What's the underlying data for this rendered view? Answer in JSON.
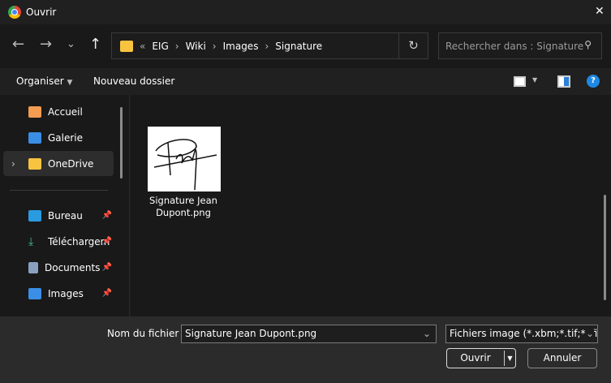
{
  "window": {
    "title": "Ouvrir",
    "close": "✕"
  },
  "nav": {
    "back": "←",
    "forward": "→",
    "recent": "⌄",
    "up": "↑",
    "breadcrumb": [
      "EIG",
      "Wiki",
      "Images",
      "Signature"
    ],
    "overflow": "«",
    "refresh": "↻"
  },
  "search": {
    "placeholder": "Rechercher dans : Signature"
  },
  "toolbar": {
    "organize": "Organiser",
    "new_folder": "Nouveau dossier"
  },
  "sidebar": {
    "items": [
      {
        "label": "Accueil",
        "icon": "home-icon"
      },
      {
        "label": "Galerie",
        "icon": "gallery-icon"
      },
      {
        "label": "OneDrive",
        "icon": "folder-icon",
        "selected": true
      },
      {
        "label": "Bureau",
        "icon": "desktop-icon",
        "pinned": true
      },
      {
        "label": "Téléchargem",
        "icon": "download-icon",
        "pinned": true
      },
      {
        "label": "Documents",
        "icon": "documents-icon",
        "pinned": true
      },
      {
        "label": "Images",
        "icon": "images-icon",
        "pinned": true
      }
    ]
  },
  "files": [
    {
      "name_line1": "Signature Jean",
      "name_line2": "Dupont.png"
    }
  ],
  "bottom": {
    "filename_label": "Nom du fichier :",
    "filename_value": "Signature Jean Dupont.png",
    "filetype": "Fichiers image (*.xbm;*.tif;*.jfif;",
    "open": "Ouvrir",
    "cancel": "Annuler"
  },
  "colors": {
    "accent": "#0078d4",
    "folder": "#f8c440"
  }
}
